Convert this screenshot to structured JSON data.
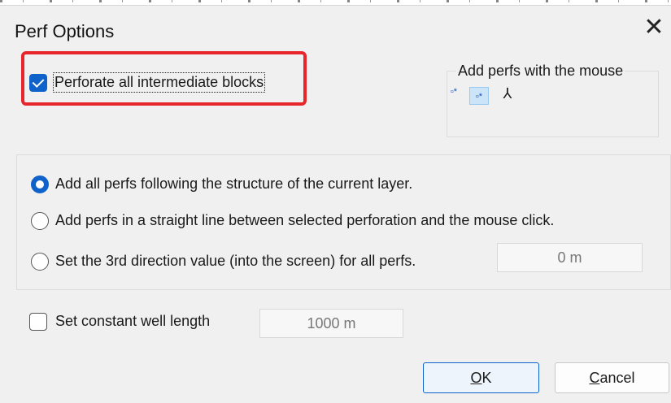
{
  "dialog": {
    "title": "Perf Options",
    "close_symbol": "✕"
  },
  "intermediate": {
    "label": "Perforate all intermediate blocks",
    "checked": true
  },
  "mouse_group": {
    "legend": "Add perfs with the mouse",
    "icons": [
      {
        "name": "perf-arrow-star-icon",
        "glyph": "▫*",
        "selected": false
      },
      {
        "name": "perf-arrow-star-selected-icon",
        "glyph": "▫*",
        "selected": true
      },
      {
        "name": "perf-tripod-icon",
        "glyph": "⅄",
        "selected": false
      }
    ]
  },
  "structure_options": {
    "option1": {
      "label": "Add all perfs following the structure of the current layer.",
      "checked": true
    },
    "option2": {
      "label": "Add perfs in a straight line between selected perforation and the mouse click.",
      "checked": false
    },
    "option3": {
      "label": "Set the 3rd direction value (into the screen) for all perfs.",
      "checked": false
    },
    "direction_value": "0 m"
  },
  "well_length": {
    "label": "Set constant well length",
    "checked": false,
    "value": "1000 m"
  },
  "buttons": {
    "ok_mnemonic": "O",
    "ok_rest": "K",
    "cancel_mnemonic": "C",
    "cancel_rest": "ancel"
  },
  "colors": {
    "accent": "#0f62c9",
    "highlight": "#e8252a",
    "background": "#f0f0f0"
  }
}
